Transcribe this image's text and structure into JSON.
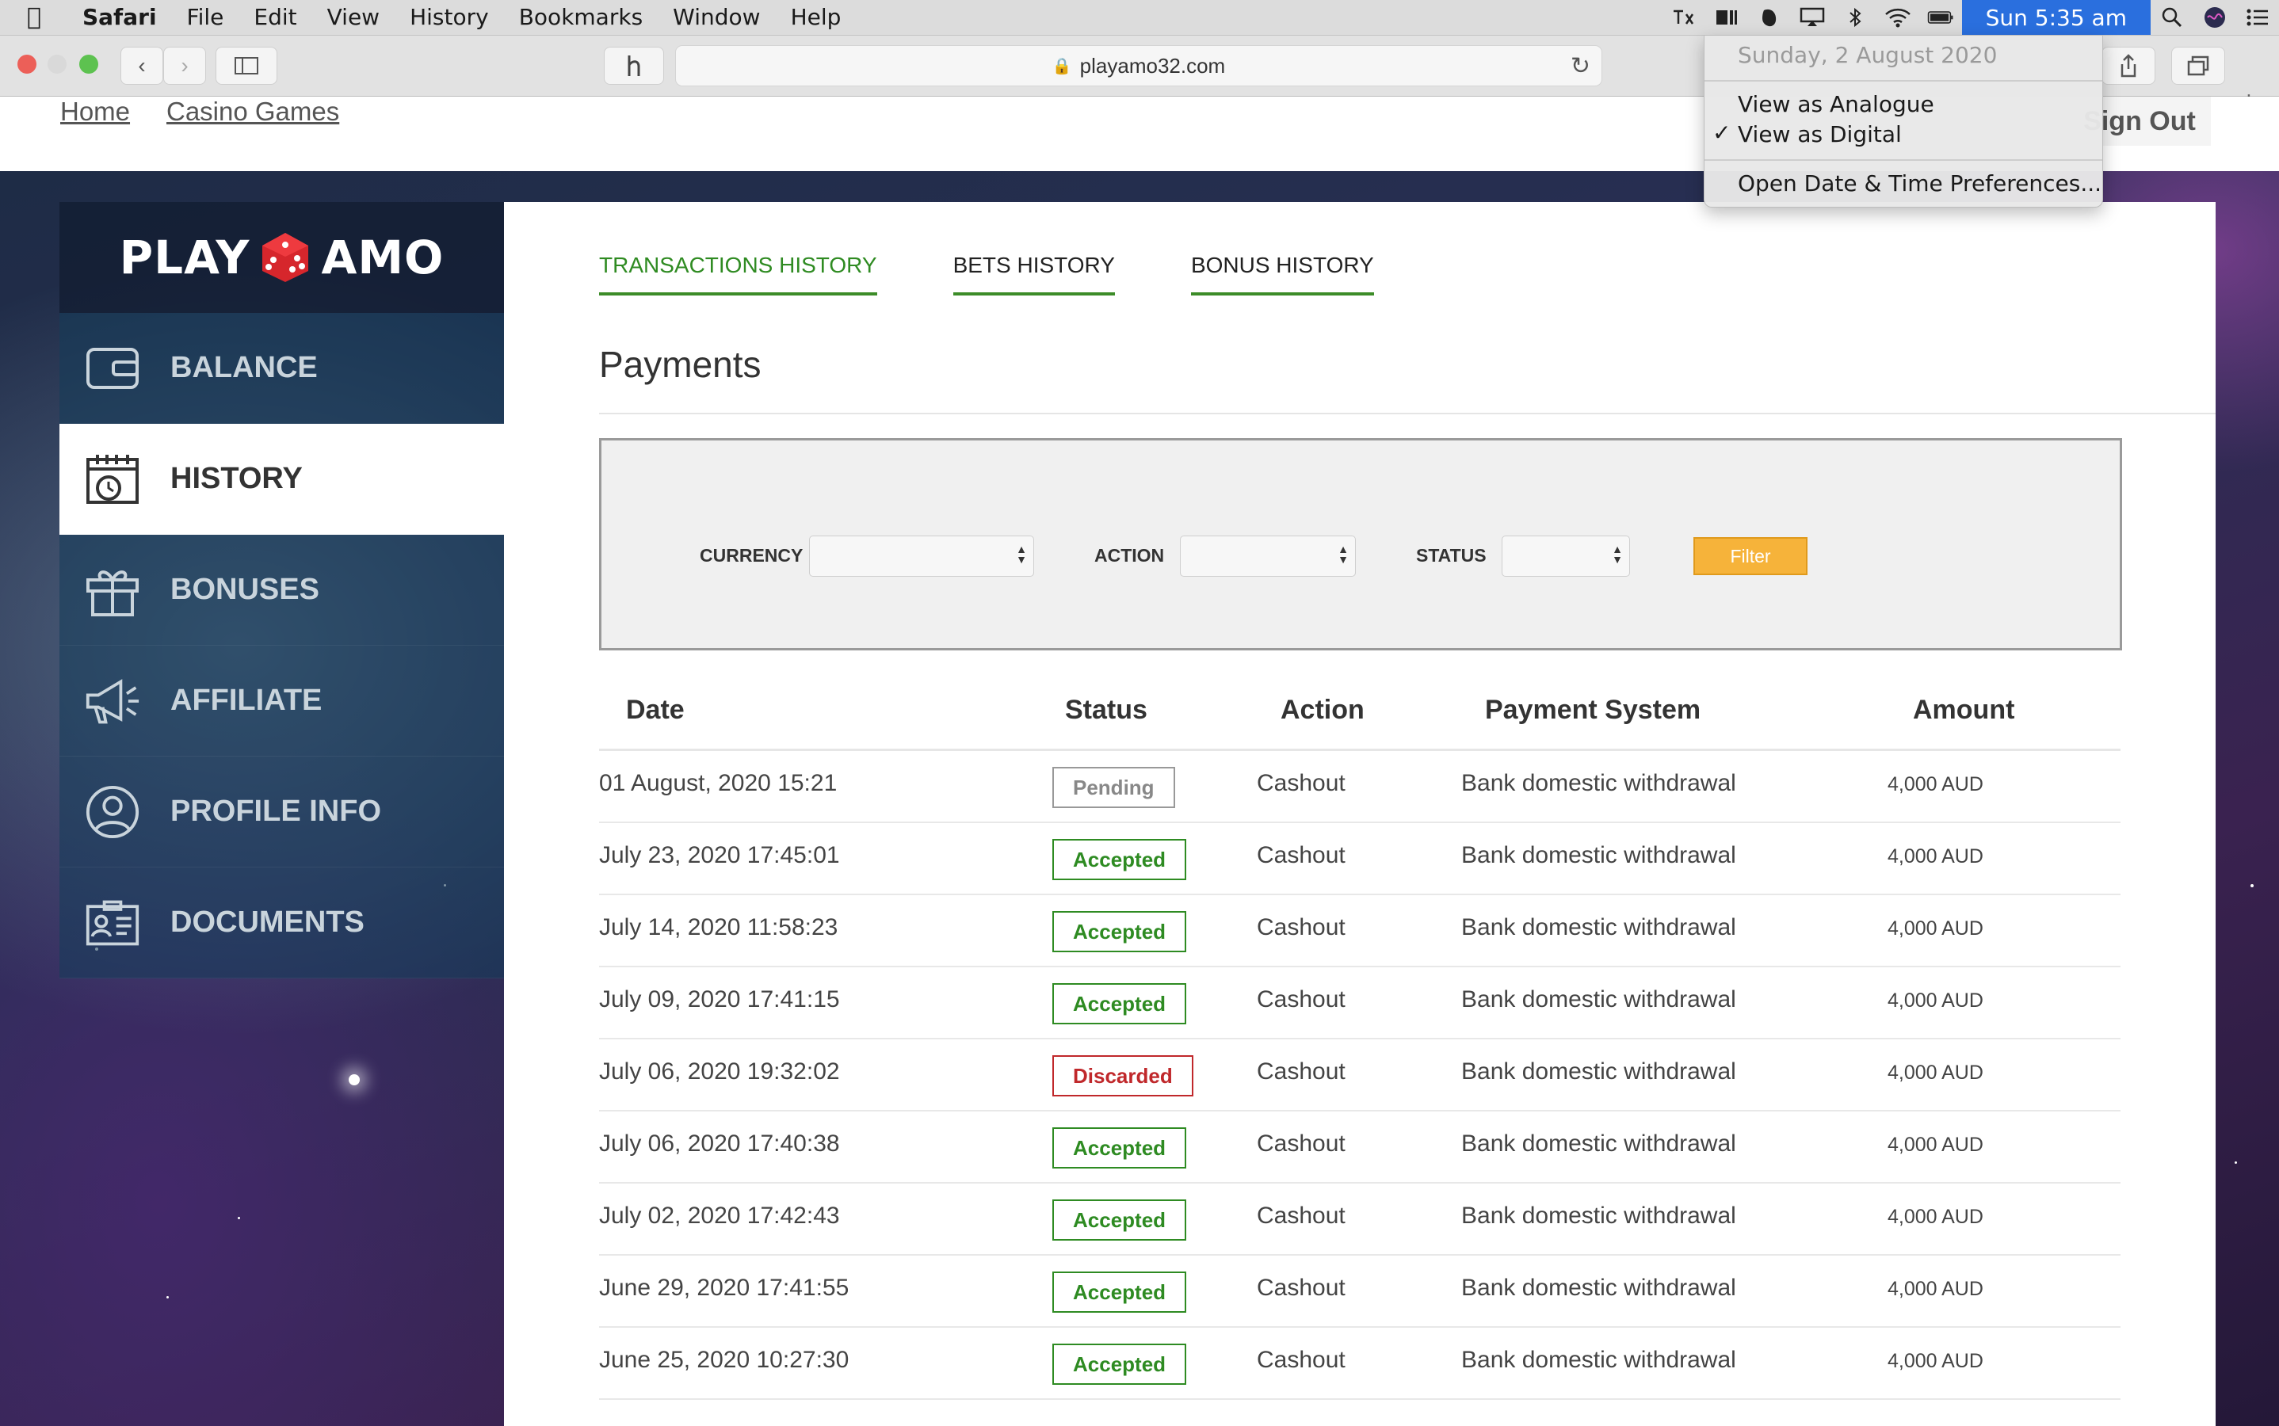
{
  "menubar": {
    "app_name": "Safari",
    "items": [
      "File",
      "Edit",
      "View",
      "History",
      "Bookmarks",
      "Window",
      "Help"
    ],
    "clock": "Sun 5:35 am"
  },
  "browser": {
    "url": "playamo32.com"
  },
  "topnav": {
    "home": "Home",
    "casino_games": "Casino Games",
    "sign_out": "Sign Out"
  },
  "logo": {
    "left": "PLAY",
    "right": "AMO"
  },
  "sidebar": {
    "items": [
      {
        "label": "BALANCE",
        "icon": "wallet-icon"
      },
      {
        "label": "HISTORY",
        "icon": "calendar-clock-icon",
        "active": true
      },
      {
        "label": "BONUSES",
        "icon": "gift-icon"
      },
      {
        "label": "AFFILIATE",
        "icon": "megaphone-icon"
      },
      {
        "label": "PROFILE INFO",
        "icon": "user-icon"
      },
      {
        "label": "DOCUMENTS",
        "icon": "id-card-icon"
      }
    ]
  },
  "tabs": [
    {
      "label": "TRANSACTIONS HISTORY",
      "active": true
    },
    {
      "label": "BETS HISTORY",
      "active": false
    },
    {
      "label": "BONUS HISTORY",
      "active": false
    }
  ],
  "section_title": "Payments",
  "filters": {
    "currency_label": "CURRENCY",
    "action_label": "ACTION",
    "status_label": "STATUS",
    "button": "Filter"
  },
  "table": {
    "headers": {
      "date": "Date",
      "status": "Status",
      "action": "Action",
      "payment_system": "Payment System",
      "amount": "Amount"
    },
    "rows": [
      {
        "date": "01 August, 2020 15:21",
        "status": "Pending",
        "action": "Cashout",
        "system": "Bank domestic withdrawal",
        "amount": "4,000 AUD"
      },
      {
        "date": "July 23, 2020 17:45:01",
        "status": "Accepted",
        "action": "Cashout",
        "system": "Bank domestic withdrawal",
        "amount": "4,000 AUD"
      },
      {
        "date": "July 14, 2020 11:58:23",
        "status": "Accepted",
        "action": "Cashout",
        "system": "Bank domestic withdrawal",
        "amount": "4,000 AUD"
      },
      {
        "date": "July 09, 2020 17:41:15",
        "status": "Accepted",
        "action": "Cashout",
        "system": "Bank domestic withdrawal",
        "amount": "4,000 AUD"
      },
      {
        "date": "July 06, 2020 19:32:02",
        "status": "Discarded",
        "action": "Cashout",
        "system": "Bank domestic withdrawal",
        "amount": "4,000 AUD"
      },
      {
        "date": "July 06, 2020 17:40:38",
        "status": "Accepted",
        "action": "Cashout",
        "system": "Bank domestic withdrawal",
        "amount": "4,000 AUD"
      },
      {
        "date": "July 02, 2020 17:42:43",
        "status": "Accepted",
        "action": "Cashout",
        "system": "Bank domestic withdrawal",
        "amount": "4,000 AUD"
      },
      {
        "date": "June 29, 2020 17:41:55",
        "status": "Accepted",
        "action": "Cashout",
        "system": "Bank domestic withdrawal",
        "amount": "4,000 AUD"
      },
      {
        "date": "June 25, 2020 10:27:30",
        "status": "Accepted",
        "action": "Cashout",
        "system": "Bank domestic withdrawal",
        "amount": "4,000 AUD"
      }
    ]
  },
  "clock_menu": {
    "date": "Sunday, 2 August 2020",
    "view_analogue": "View as Analogue",
    "view_digital": "View as Digital",
    "preferences": "Open Date & Time Preferences..."
  },
  "colors": {
    "accent_green": "#2f8b22",
    "discarded_red": "#c0282b",
    "filter_orange": "#f6b33a",
    "clock_blue": "#2a6fde"
  }
}
